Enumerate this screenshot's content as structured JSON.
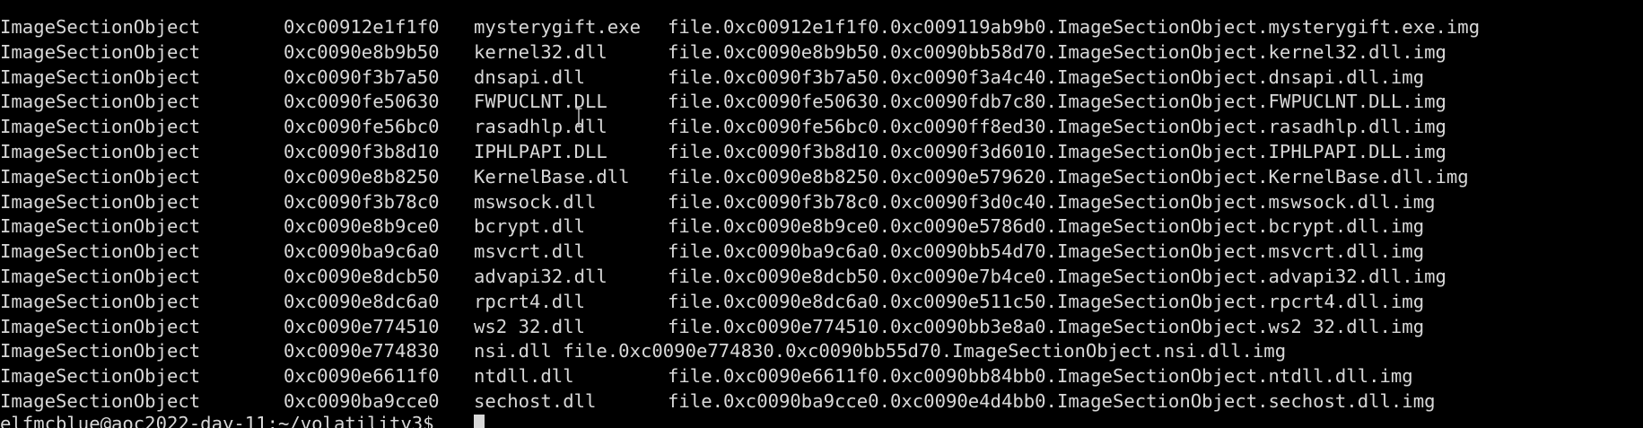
{
  "terminal": {
    "rows": [
      {
        "type": "ImageSectionObject",
        "offset": "0xc00912e1f1f0",
        "name": "mysterygift.exe",
        "file": "file.0xc00912e1f1f0.0xc009119ab9b0.ImageSectionObject.mysterygift.exe.img"
      },
      {
        "type": "ImageSectionObject",
        "offset": "0xc0090e8b9b50",
        "name": "kernel32.dll",
        "file": "file.0xc0090e8b9b50.0xc0090bb58d70.ImageSectionObject.kernel32.dll.img"
      },
      {
        "type": "ImageSectionObject",
        "offset": "0xc0090f3b7a50",
        "name": "dnsapi.dll",
        "file": "file.0xc0090f3b7a50.0xc0090f3a4c40.ImageSectionObject.dnsapi.dll.img"
      },
      {
        "type": "ImageSectionObject",
        "offset": "0xc0090fe50630",
        "name": "FWPUCLNT.DLL",
        "file": "file.0xc0090fe50630.0xc0090fdb7c80.ImageSectionObject.FWPUCLNT.DLL.img"
      },
      {
        "type": "ImageSectionObject",
        "offset": "0xc0090fe56bc0",
        "name": "rasadhlp.dll",
        "file": "file.0xc0090fe56bc0.0xc0090ff8ed30.ImageSectionObject.rasadhlp.dll.img"
      },
      {
        "type": "ImageSectionObject",
        "offset": "0xc0090f3b8d10",
        "name": "IPHLPAPI.DLL",
        "file": "file.0xc0090f3b8d10.0xc0090f3d6010.ImageSectionObject.IPHLPAPI.DLL.img"
      },
      {
        "type": "ImageSectionObject",
        "offset": "0xc0090e8b8250",
        "name": "KernelBase.dll",
        "file": "file.0xc0090e8b8250.0xc0090e579620.ImageSectionObject.KernelBase.dll.img"
      },
      {
        "type": "ImageSectionObject",
        "offset": "0xc0090f3b78c0",
        "name": "mswsock.dll",
        "file": "file.0xc0090f3b78c0.0xc0090f3d0c40.ImageSectionObject.mswsock.dll.img"
      },
      {
        "type": "ImageSectionObject",
        "offset": "0xc0090e8b9ce0",
        "name": "bcrypt.dll",
        "file": "file.0xc0090e8b9ce0.0xc0090e5786d0.ImageSectionObject.bcrypt.dll.img"
      },
      {
        "type": "ImageSectionObject",
        "offset": "0xc0090ba9c6a0",
        "name": "msvcrt.dll",
        "file": "file.0xc0090ba9c6a0.0xc0090bb54d70.ImageSectionObject.msvcrt.dll.img"
      },
      {
        "type": "ImageSectionObject",
        "offset": "0xc0090e8dcb50",
        "name": "advapi32.dll",
        "file": "file.0xc0090e8dcb50.0xc0090e7b4ce0.ImageSectionObject.advapi32.dll.img"
      },
      {
        "type": "ImageSectionObject",
        "offset": "0xc0090e8dc6a0",
        "name": "rpcrt4.dll",
        "file": "file.0xc0090e8dc6a0.0xc0090e511c50.ImageSectionObject.rpcrt4.dll.img"
      },
      {
        "type": "ImageSectionObject",
        "offset": "0xc0090e774510",
        "name": "ws2 32.dll",
        "file": "file.0xc0090e774510.0xc0090bb3e8a0.ImageSectionObject.ws2 32.dll.img"
      },
      {
        "type": "ImageSectionObject",
        "offset": "0xc0090e774830",
        "name": "nsi.dll file.0xc0090e774830.0xc0090bb55d70.ImageSectionObject.nsi.dll.img",
        "file": ""
      },
      {
        "type": "ImageSectionObject",
        "offset": "0xc0090e6611f0",
        "name": "ntdll.dll",
        "file": "file.0xc0090e6611f0.0xc0090bb84bb0.ImageSectionObject.ntdll.dll.img"
      },
      {
        "type": "ImageSectionObject",
        "offset": "0xc0090ba9cce0",
        "name": "sechost.dll",
        "file": "file.0xc0090ba9cce0.0xc0090e4d4bb0.ImageSectionObject.sechost.dll.img"
      }
    ],
    "prompt": "elfmcblue@aoc2022-day-11:~/volatility3$ ",
    "colors": {
      "background": "#000000",
      "text": "#d8d8d8"
    }
  }
}
